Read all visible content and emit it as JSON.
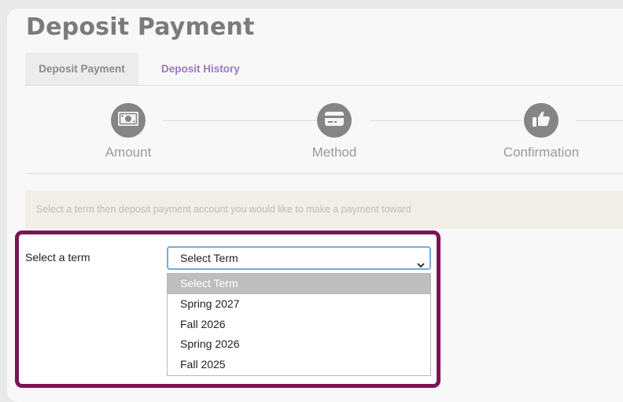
{
  "page": {
    "title": "Deposit Payment"
  },
  "tabs": [
    {
      "label": "Deposit Payment",
      "active": true
    },
    {
      "label": "Deposit History",
      "active": false
    }
  ],
  "steps": [
    {
      "label": "Amount",
      "icon": "money-icon"
    },
    {
      "label": "Method",
      "icon": "credit-card-icon"
    },
    {
      "label": "Confirmation",
      "icon": "thumbs-up-icon"
    }
  ],
  "alert": {
    "text": "Select a term then deposit payment account you would like to make a payment toward"
  },
  "term_select": {
    "label": "Select a term",
    "value": "Select Term",
    "options": [
      "Select Term",
      "Spring 2027",
      "Fall 2026",
      "Spring 2026",
      "Fall 2025"
    ],
    "highlighted": "Select Term"
  },
  "colors": {
    "focus_border": "#7b1553",
    "link": "#9b79bf",
    "step_circle": "#858585",
    "alert_bg": "#f1eee7",
    "select_border": "#7aa9d9"
  }
}
